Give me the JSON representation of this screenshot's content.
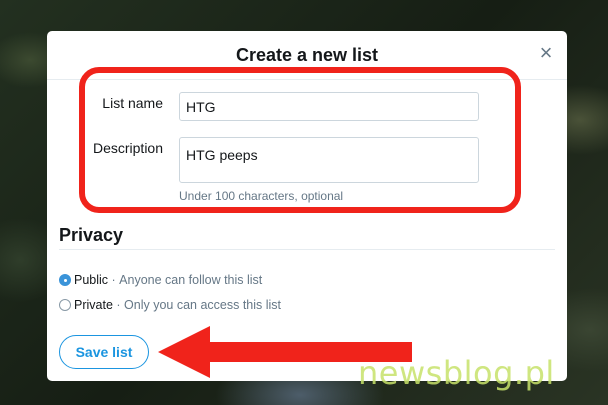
{
  "dialog": {
    "title": "Create a new list",
    "close_icon": "close-icon"
  },
  "form": {
    "list_name_label": "List name",
    "list_name_value": "HTG",
    "description_label": "Description",
    "description_value": "HTG peeps",
    "description_hint": "Under 100 characters, optional"
  },
  "privacy": {
    "heading": "Privacy",
    "options": [
      {
        "label": "Public",
        "desc": "Anyone can follow this list",
        "checked": true
      },
      {
        "label": "Private",
        "desc": "Only you can access this list",
        "checked": false
      }
    ]
  },
  "actions": {
    "save_label": "Save list"
  },
  "annotation": {
    "highlight_color": "#f0231b",
    "arrow_color": "#f0231b"
  },
  "watermark": {
    "text": "newsblog.pl"
  },
  "colors": {
    "accent": "#1b95e0",
    "radio_checked": "#3b94d9"
  }
}
